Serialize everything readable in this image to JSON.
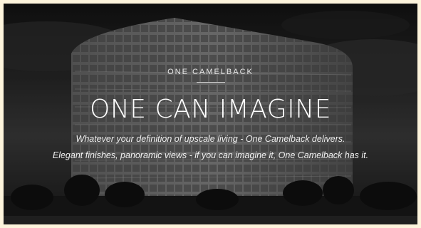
{
  "hero": {
    "eyebrow": "ONE CAMELBACK",
    "headline": "ONE CAN IMAGINE",
    "tagline_line1": "Whatever your definition of upscale living - One Camelback delivers.",
    "tagline_line2": "Elegant finishes, panoramic views - if you can imagine it, One Camelback has it."
  },
  "colors": {
    "page_border": "#fdf4dc",
    "text": "#ffffff"
  }
}
